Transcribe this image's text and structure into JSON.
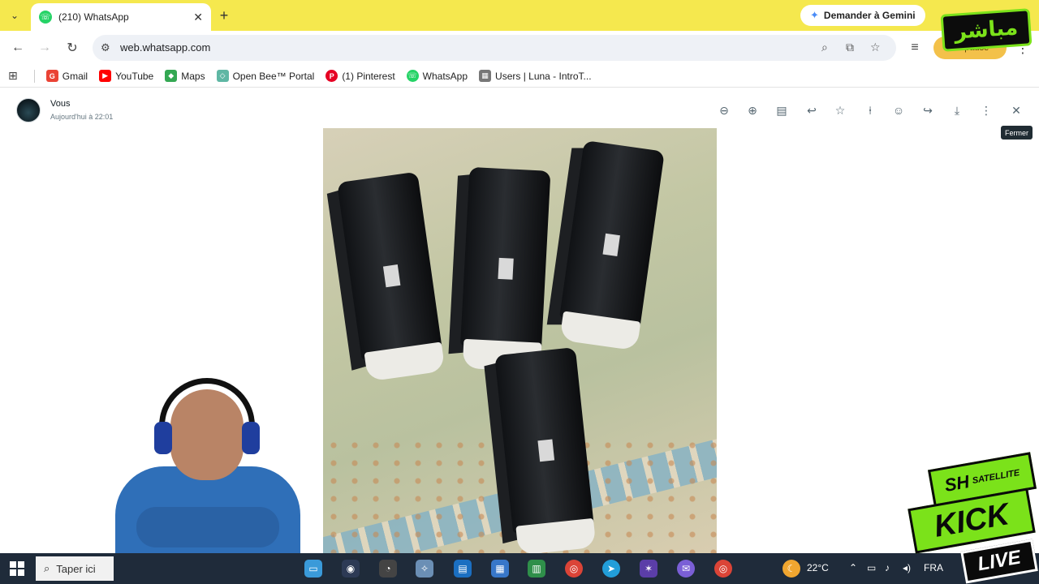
{
  "browser": {
    "tab": {
      "title": "(210) WhatsApp"
    },
    "gemini_button": "Demander à Gemini",
    "url": "web.whatsapp.com",
    "profile_label": "En pause"
  },
  "bookmarks": [
    {
      "label": "Gmail",
      "icon": "gmail-icon",
      "color": "#ea4335"
    },
    {
      "label": "YouTube",
      "icon": "youtube-icon",
      "color": "#ff0000"
    },
    {
      "label": "Maps",
      "icon": "maps-icon",
      "color": "#34a853"
    },
    {
      "label": "Open Bee™ Portal",
      "icon": "openbee-icon",
      "color": "#5fb7a4"
    },
    {
      "label": "(1) Pinterest",
      "icon": "pinterest-icon",
      "color": "#e60023"
    },
    {
      "label": "WhatsApp",
      "icon": "whatsapp-icon",
      "color": "#25d366"
    },
    {
      "label": "Users | Luna - IntroT...",
      "icon": "grid-icon",
      "color": "#777777"
    }
  ],
  "viewer": {
    "sender": "Vous",
    "time": "Aujourd'hui à 22:01",
    "tooltip": "Fermer",
    "tools": [
      "zoom-out-icon",
      "zoom-in-icon",
      "caption-icon",
      "reply-icon",
      "star-icon",
      "pin-icon",
      "emoji-icon",
      "forward-icon",
      "download-icon",
      "more-icon",
      "close-icon"
    ]
  },
  "taskbar": {
    "search_placeholder": "Taper ici",
    "weather": "22°C",
    "language": "FRA"
  },
  "overlays": {
    "channel_badge": "مباشر",
    "brand_top": "SH",
    "brand_sub": "SATELLITE",
    "brand_main": "KICK",
    "brand_live": "LIVE"
  },
  "colors": {
    "tabstrip": "#f5e84e",
    "whatsapp_green": "#25d366",
    "kick_green": "#7be21a",
    "taskbar": "#1f2b3a"
  }
}
